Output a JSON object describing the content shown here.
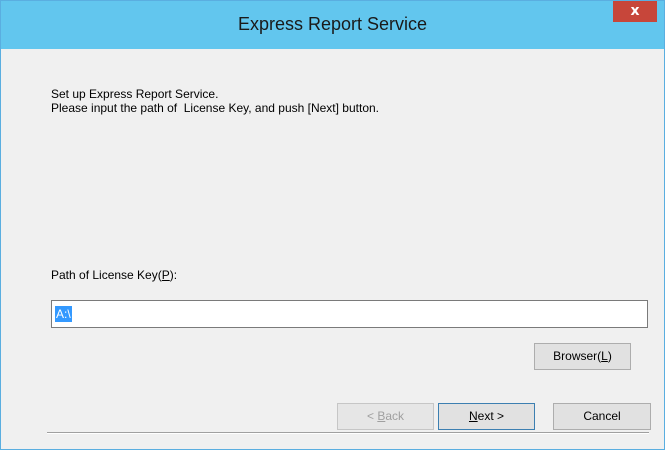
{
  "window": {
    "title": "Express Report Service",
    "close_label": "x"
  },
  "instructions": {
    "line1": "Set up Express Report Service.",
    "line2": "Please input the path of  License Key, and push [Next] button."
  },
  "license": {
    "label_prefix": "Path of License Key(",
    "label_accel": "P",
    "label_suffix": "):",
    "path_value": "A:\\"
  },
  "buttons": {
    "browser_prefix": "Browser(",
    "browser_accel": "L",
    "browser_suffix": ")",
    "back_prefix": "< ",
    "back_accel": "B",
    "back_suffix": "ack",
    "next_accel": "N",
    "next_suffix": "ext >",
    "cancel_label": "Cancel"
  }
}
